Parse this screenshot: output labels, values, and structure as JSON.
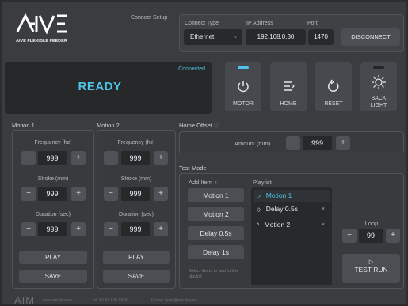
{
  "brand": {
    "logo_text": "AIVE",
    "tagline": "AIVE FLEXIBLE FEEDER"
  },
  "connect": {
    "section_label": "Connect Setup",
    "type_label": "Connect Type",
    "type_value": "Ethernet",
    "ip_label": "IP Address",
    "ip_value": "192.168.0.30",
    "port_label": "Port",
    "port_value": "1470",
    "disconnect_label": "DISCONNECT"
  },
  "status": {
    "connection": "Connected",
    "state": "READY"
  },
  "controls": [
    {
      "label": "MOTOR",
      "icon": "power-icon",
      "indicator": "#4fc3e8"
    },
    {
      "label": "HOME",
      "icon": "home-menu-icon",
      "indicator": null
    },
    {
      "label": "RESET",
      "icon": "reset-icon",
      "indicator": null
    },
    {
      "label": "BACK\nLIGHT",
      "icon": "backlight-icon",
      "indicator": "#2a2c2e"
    }
  ],
  "motion1": {
    "title": "Motion 1",
    "frequency_label": "Frequency (hz)",
    "frequency": "999",
    "stroke_label": "Stroke (mm)",
    "stroke": "999",
    "duration_label": "Duration (sec)",
    "duration": "999",
    "play_label": "PLAY",
    "save_label": "SAVE"
  },
  "motion2": {
    "title": "Motion 2",
    "frequency_label": "Frequency (hz)",
    "frequency": "999",
    "stroke_label": "Stroke (mm)",
    "stroke": "999",
    "duration_label": "Duration (sec)",
    "duration": "999",
    "play_label": "PLAY",
    "save_label": "SAVE"
  },
  "home_offset": {
    "title": "Home Offset",
    "amount_label": "Amount (mm)",
    "amount": "999"
  },
  "test_mode": {
    "title": "Test Mode",
    "add_item_label": "Add Item",
    "add_buttons": [
      "Motion 1",
      "Motion 2",
      "Delay 0.5s",
      "Delay 1s"
    ],
    "hint": "Select items to add to the playlist",
    "playlist_label": "Playlist",
    "playlist": [
      {
        "prefix": "▷",
        "label": "Motion 1",
        "active": true
      },
      {
        "prefix": "◇",
        "label": "Delay 0.5s",
        "active": false
      },
      {
        "prefix": "^",
        "label": "Motion 2",
        "active": false
      }
    ],
    "loop_label": "Loop",
    "loop_value": "99",
    "test_run_label": "TEST RUN"
  },
  "footer": {
    "logo": "AIM",
    "web": "www.aim-fa.com",
    "tel": "Tel. 82-31-548-6368",
    "email": "E-mail: hyun@aim-fa.com"
  },
  "colors": {
    "accent": "#4fc3e8",
    "ready": "#4fc3e8"
  }
}
